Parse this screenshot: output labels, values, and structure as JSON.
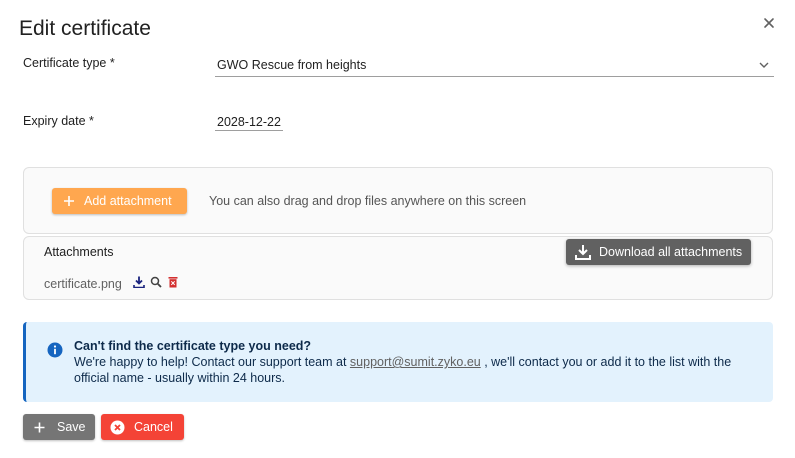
{
  "dialog": {
    "title": "Edit certificate",
    "close_icon": "close-icon"
  },
  "form": {
    "certificate_type_label": "Certificate type  *",
    "certificate_type_value": "GWO Rescue from heights",
    "expiry_date_label": "Expiry date  *",
    "expiry_date_value": "2028-12-22"
  },
  "upload": {
    "add_label": "Add attachment",
    "hint": "You can also drag and drop files anywhere on this screen"
  },
  "attachments": {
    "title": "Attachments",
    "download_all_label": "Download all attachments",
    "files": [
      {
        "name": "certificate.png"
      }
    ]
  },
  "info": {
    "heading": "Can't find the certificate type you need?",
    "line1_prefix": "We're happy to help! Contact our support team at ",
    "email": "support@sumit.zyko.eu",
    "line1_suffix": " , we'll contact you or add it to the list with the",
    "line2": "official name - usually within 24 hours."
  },
  "actions": {
    "save_label": "Save",
    "cancel_label": "Cancel"
  },
  "colors": {
    "accent_orange": "#ffa74f",
    "cancel_red": "#f44336",
    "save_grey": "#757575",
    "info_blue_bg": "#e3f2fd",
    "info_blue_border": "#1565c0",
    "download_blue": "#1a237e",
    "delete_red": "#d32f2f"
  }
}
